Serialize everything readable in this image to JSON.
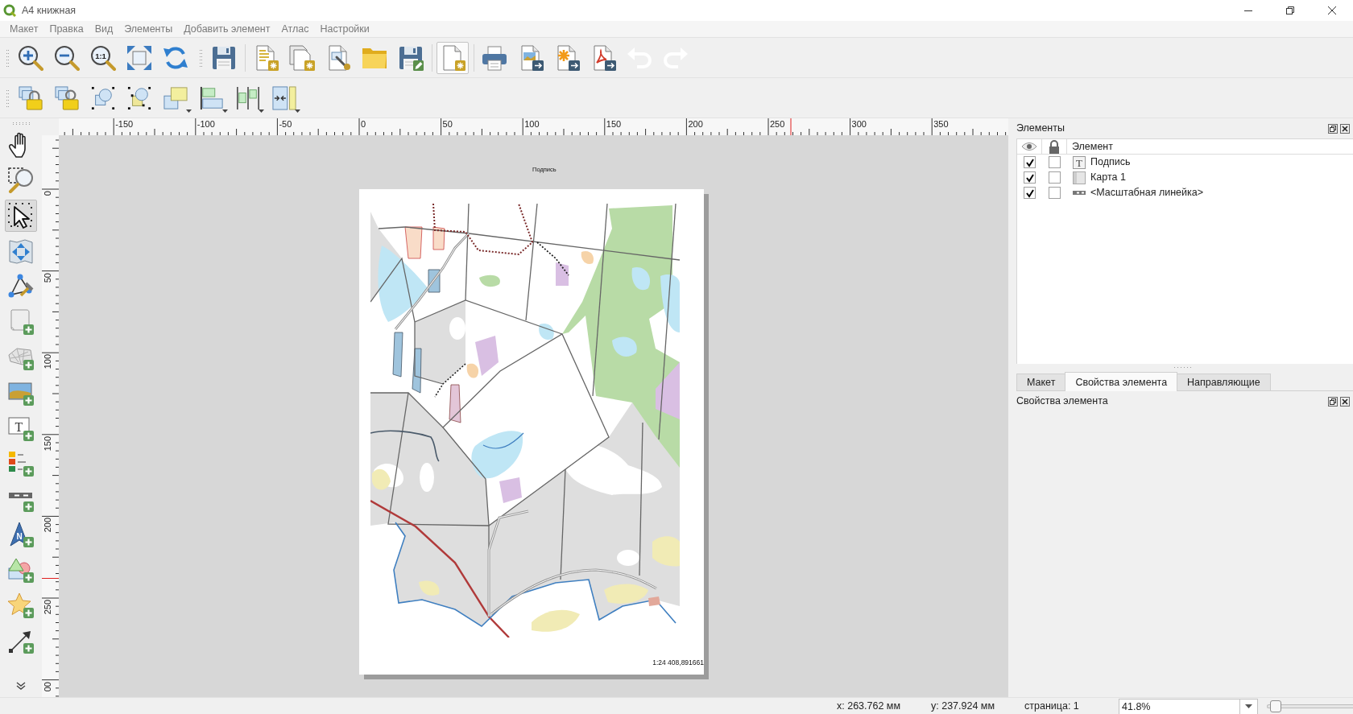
{
  "window": {
    "title": "A4 книжная"
  },
  "menu": [
    "Макет",
    "Правка",
    "Вид",
    "Элементы",
    "Добавить элемент",
    "Атлас",
    "Настройки"
  ],
  "main_toolbar": [
    {
      "disabled": false,
      "hovered": false
    },
    {
      "disabled": false,
      "hovered": false
    },
    {
      "disabled": false,
      "hovered": false,
      "glyph": "1:1"
    },
    {
      "disabled": false,
      "hovered": false
    },
    {
      "disabled": false,
      "hovered": false
    },
    {
      "disabled": false,
      "hovered": false
    },
    {
      "disabled": false,
      "hovered": false
    },
    {
      "disabled": false,
      "hovered": false
    },
    {
      "disabled": false,
      "hovered": false
    },
    {
      "disabled": false,
      "hovered": false
    },
    {
      "disabled": false,
      "hovered": false
    },
    {
      "disabled": false,
      "hovered": true
    },
    {
      "disabled": false,
      "hovered": false
    },
    {
      "disabled": false,
      "hovered": false
    },
    {
      "disabled": false,
      "hovered": false
    },
    {
      "disabled": false,
      "hovered": false
    },
    {
      "disabled": true,
      "hovered": false
    },
    {
      "disabled": true,
      "hovered": false
    }
  ],
  "layout_toolbar": [
    {
      "dropdown": false
    },
    {
      "dropdown": false
    },
    {
      "dropdown": false
    },
    {
      "dropdown": false
    },
    {
      "dropdown": true
    },
    {
      "dropdown": true
    },
    {
      "dropdown": true
    },
    {
      "dropdown": true
    }
  ],
  "tool_panel": [
    {
      "selected": false
    },
    {
      "selected": false
    },
    {
      "selected": true
    },
    {
      "selected": false
    },
    {
      "selected": false
    },
    {
      "selected": false
    },
    {
      "selected": false
    },
    {
      "selected": false
    },
    {
      "selected": false,
      "glyph": "T"
    },
    {
      "selected": false
    },
    {
      "selected": false
    },
    {
      "selected": false,
      "glyph": "N"
    },
    {
      "selected": false
    },
    {
      "selected": false
    },
    {
      "selected": false
    }
  ],
  "rulers": {
    "horizontal": [
      "-150",
      "-100",
      "-50",
      "0",
      "50",
      "100",
      "150",
      "200",
      "250",
      "300",
      "350"
    ],
    "vertical": [
      "0",
      "50",
      "100",
      "150",
      "200",
      "250",
      "00"
    ]
  },
  "canvas": {
    "label_item": "Подпись",
    "scale_text": "1:24 408,891661"
  },
  "items_panel": {
    "title": "Элементы",
    "column": "Элемент",
    "rows": [
      {
        "kind": "label",
        "glyph": "T",
        "name": "Подпись",
        "visible": true,
        "locked": false
      },
      {
        "kind": "map",
        "name": "Карта 1",
        "visible": true,
        "locked": false
      },
      {
        "kind": "scalebar",
        "name": "<Масштабная линейка>",
        "visible": true,
        "locked": false
      }
    ]
  },
  "tabs": [
    {
      "label": "Макет",
      "selected": false
    },
    {
      "label": "Свойства элемента",
      "selected": true
    },
    {
      "label": "Направляющие",
      "selected": false
    }
  ],
  "properties_panel": {
    "title": "Свойства элемента"
  },
  "status_bar": {
    "x": "x: 263.762 мм",
    "y": "y: 237.924 мм",
    "page": "страница: 1",
    "zoom": "41.8%",
    "zoom_slider": {
      "level": 0.02
    }
  }
}
